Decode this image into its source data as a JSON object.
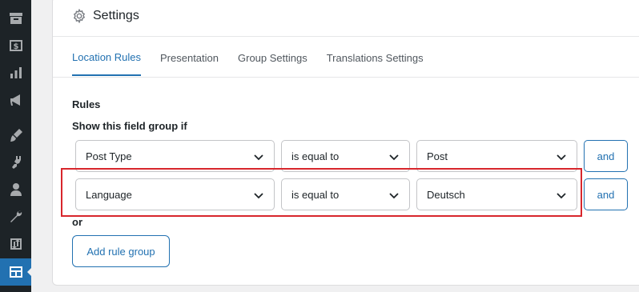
{
  "sidebar": {
    "items": [
      {
        "icon": "archive-icon",
        "active": false
      },
      {
        "icon": "money-icon",
        "active": false
      },
      {
        "icon": "chart-bar-icon",
        "active": false
      },
      {
        "icon": "megaphone-icon",
        "active": false
      },
      {
        "icon": "paintbrush-icon",
        "active": false
      },
      {
        "icon": "plugin-icon",
        "active": false
      },
      {
        "icon": "user-icon",
        "active": false
      },
      {
        "icon": "wrench-icon",
        "active": false
      },
      {
        "icon": "sort-icon",
        "active": false
      },
      {
        "icon": "field-groups-icon",
        "active": true
      }
    ]
  },
  "panel": {
    "title": "Settings",
    "icon": "gear-icon"
  },
  "tabs": [
    {
      "label": "Location Rules",
      "active": true
    },
    {
      "label": "Presentation",
      "active": false
    },
    {
      "label": "Group Settings",
      "active": false
    },
    {
      "label": "Translations Settings",
      "active": false
    }
  ],
  "rules": {
    "heading": "Rules",
    "show_if": "Show this field group if",
    "rows": [
      {
        "param": "Post Type",
        "operator": "is equal to",
        "value": "Post",
        "and_label": "and"
      },
      {
        "param": "Language",
        "operator": "is equal to",
        "value": "Deutsch",
        "and_label": "and"
      }
    ],
    "or_label": "or",
    "add_group_label": "Add rule group"
  },
  "colors": {
    "accent": "#2271b1",
    "highlight": "#d8262c",
    "sidebar_bg": "#1d2327"
  }
}
